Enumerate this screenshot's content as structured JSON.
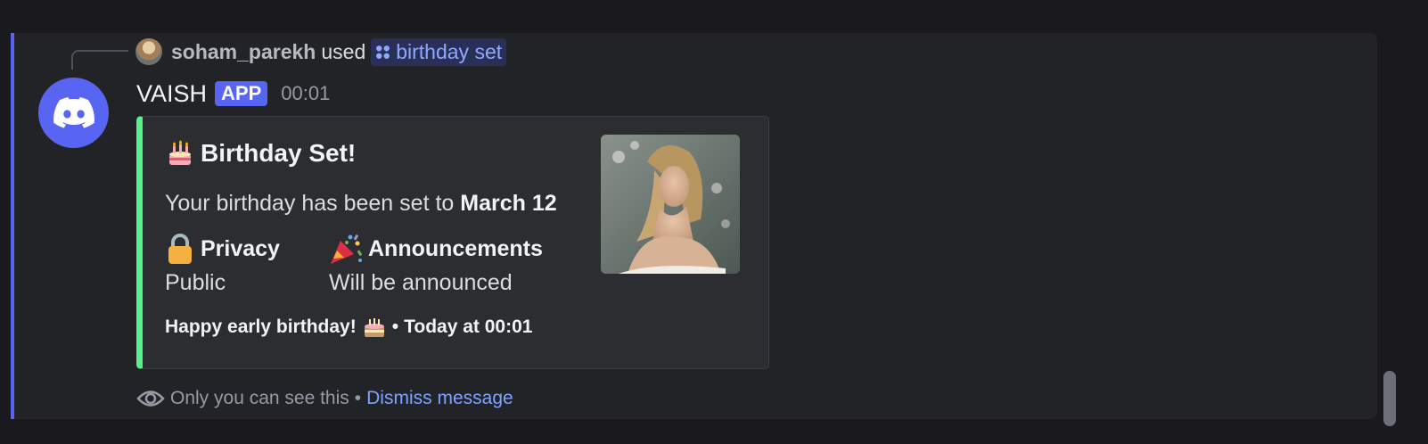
{
  "reply": {
    "username": "soham_parekh",
    "action": "used",
    "command": "birthday set"
  },
  "message": {
    "author": "VAISH",
    "badge": "APP",
    "time": "00:01"
  },
  "embed": {
    "accent_color": "#57f287",
    "title": "Birthday Set!",
    "description_prefix": "Your birthday has been set to ",
    "date": "March 12",
    "fields": [
      {
        "name": "Privacy",
        "value": "Public",
        "icon": "lock-icon"
      },
      {
        "name": "Announcements",
        "value": "Will be announced",
        "icon": "party-popper-icon"
      }
    ],
    "footer_text": "Happy early birthday!",
    "footer_separator": "•",
    "footer_timestamp": "Today at 00:01"
  },
  "ephemeral": {
    "notice": "Only you can see this",
    "separator": "•",
    "dismiss_label": "Dismiss message"
  },
  "colors": {
    "brand": "#5865f2",
    "link": "#7ea2ff",
    "embed_bar": "#57f287"
  }
}
